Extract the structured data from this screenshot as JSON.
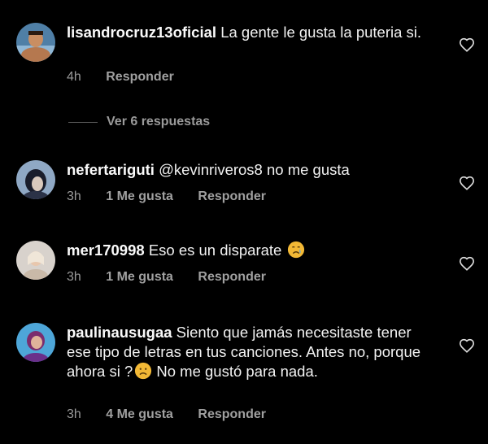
{
  "comments": [
    {
      "username": "lisandrocruz13oficial",
      "text": "La gente le gusta la puteria si.",
      "time": "4h",
      "likes": "",
      "reply_label": "Responder"
    },
    {
      "username": "nefertariguti",
      "text": "@kevinriveros8 no me gusta",
      "time": "3h",
      "likes": "1 Me gusta",
      "reply_label": "Responder"
    },
    {
      "username": "mer170998",
      "text": "Eso es un disparate",
      "emoji": "crying-face",
      "time": "3h",
      "likes": "1 Me gusta",
      "reply_label": "Responder"
    },
    {
      "username": "paulinausugaa",
      "text_part1": "Siento que jamás necesitaste tener ese tipo de letras en tus canciones. Antes no, porque ahora si ?",
      "emoji": "frowning-face",
      "text_part2": " No me gustó para nada.",
      "time": "3h",
      "likes": "4 Me gusta",
      "reply_label": "Responder"
    }
  ],
  "view_replies": "Ver 6 respuestas",
  "colors": {
    "background": "#000000",
    "text": "#f2f2f2",
    "meta": "#9a9a9a",
    "emoji": "#f2b835"
  }
}
